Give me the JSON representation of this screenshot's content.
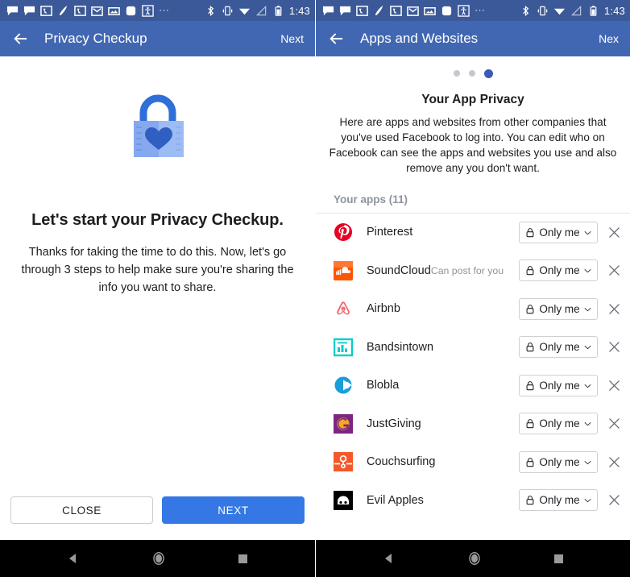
{
  "status_bar": {
    "time": "1:43",
    "icons_left": [
      "messenger-icon",
      "messenger-icon",
      "photo-app-icon",
      "feather-icon",
      "photo-app-icon",
      "gmail-icon",
      "image-icon",
      "rounded-square-icon",
      "accessibility-icon"
    ],
    "overflow": "⋯",
    "icons_right": [
      "bluetooth-icon",
      "vibrate-icon",
      "wifi-icon",
      "signal-icon",
      "battery-icon"
    ],
    "background": "#3b5998"
  },
  "colors": {
    "appbar": "#4267b2",
    "primary_button": "#3578e5",
    "muted_text": "#8d949e",
    "divider": "#e4e6eb",
    "dot_active": "#3b5bb5",
    "dot_inactive": "#c4c8d0"
  },
  "left_screen": {
    "appbar": {
      "back_icon": "arrow-left-icon",
      "title": "Privacy Checkup",
      "next_label": "Next"
    },
    "hero_icon": "padlock-heart-icon",
    "headline": "Let's start your Privacy Checkup.",
    "subtext": "Thanks for taking the time to do this. Now, let's go through 3 steps to help make sure you're sharing the info you want to share.",
    "buttons": {
      "close_label": "CLOSE",
      "next_label": "NEXT"
    }
  },
  "right_screen": {
    "appbar": {
      "back_icon": "arrow-left-icon",
      "title": "Apps and Websites",
      "next_label": "Nex"
    },
    "pager": {
      "total": 3,
      "active_index": 2
    },
    "title": "Your App Privacy",
    "description": "Here are apps and websites from other companies that you've used Facebook to log into. You can edit who on Facebook can see the apps and websites you use and also remove any you don't want.",
    "section_header": "Your apps (11)",
    "audience_lock_icon": "lock-icon",
    "audience_caret_icon": "chevron-down-icon",
    "remove_icon": "close-x-icon",
    "apps": [
      {
        "name": "Pinterest",
        "note": "",
        "icon": "pinterest-icon",
        "audience": "Only me"
      },
      {
        "name": "SoundCloud",
        "note": "Can post for you",
        "icon": "soundcloud-icon",
        "audience": "Only me"
      },
      {
        "name": "Airbnb",
        "note": "",
        "icon": "airbnb-icon",
        "audience": "Only me"
      },
      {
        "name": "Bandsintown",
        "note": "",
        "icon": "bandsintown-icon",
        "audience": "Only me"
      },
      {
        "name": "Blobla",
        "note": "",
        "icon": "blobla-icon",
        "audience": "Only me"
      },
      {
        "name": "JustGiving",
        "note": "",
        "icon": "justgiving-icon",
        "audience": "Only me"
      },
      {
        "name": "Couchsurfing",
        "note": "",
        "icon": "couchsurfing-icon",
        "audience": "Only me"
      },
      {
        "name": "Evil Apples",
        "note": "",
        "icon": "evilapples-icon",
        "audience": "Only me"
      }
    ]
  },
  "nav_bar": {
    "back_icon": "triangle-back-icon",
    "home_icon": "circle-home-icon",
    "recents_icon": "square-recents-icon"
  }
}
